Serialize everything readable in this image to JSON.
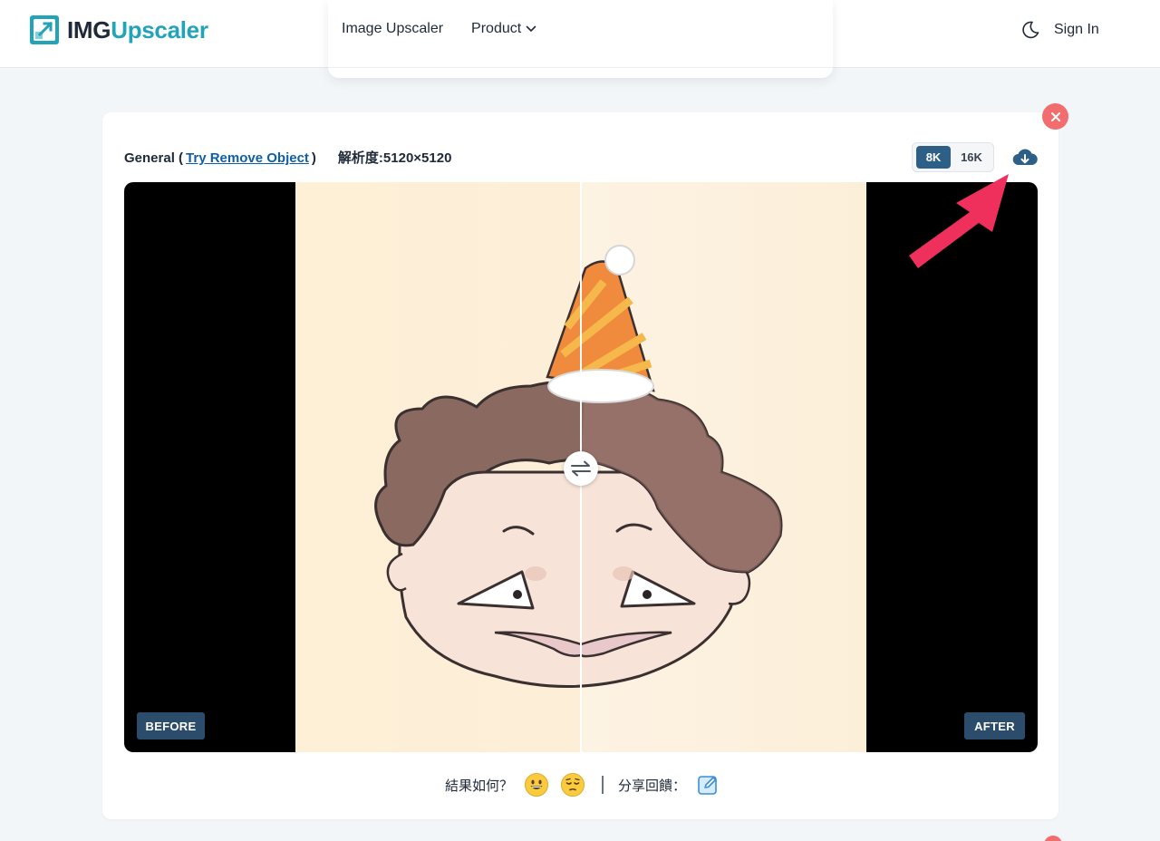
{
  "header": {
    "logo_part1": "IMG",
    "logo_part2": "Upscaler",
    "nav": [
      "Image Upscaler",
      "Product"
    ],
    "sign_in": "Sign In"
  },
  "card": {
    "mode": "General (",
    "link": "Try Remove Object",
    "mode_close": ")",
    "resolution": "解析度:5120×5120",
    "scale_options": [
      "8K",
      "16K"
    ],
    "selected_scale": "8K",
    "before_label": "BEFORE",
    "after_label": "AFTER"
  },
  "feedback": {
    "question": "結果如何？",
    "share": "分享回饋："
  },
  "colors": {
    "brand_teal": "#22a3b9",
    "tag_bg": "#2b4c6b",
    "toggle_active": "#2e5f86",
    "close_red": "#f26d6d",
    "arrow_pink": "#f0305c"
  },
  "icons": [
    "logo-icon",
    "chevron-down-icon",
    "moon-icon",
    "close-icon",
    "cloud-download-icon",
    "swap-arrows-icon",
    "grinning-emoji-icon",
    "unhappy-emoji-icon",
    "edit-icon",
    "pointer-arrow-icon"
  ]
}
